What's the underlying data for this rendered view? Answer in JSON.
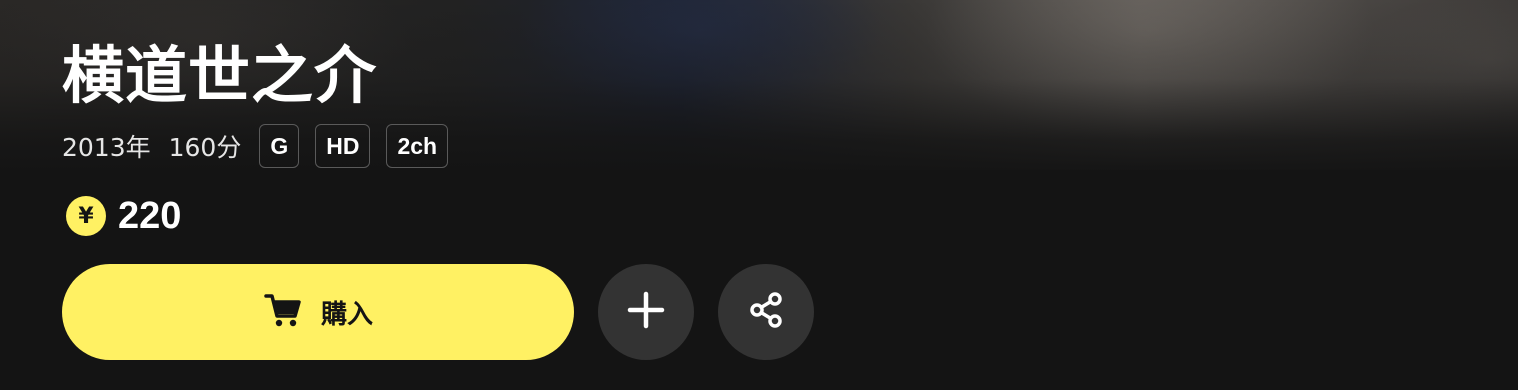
{
  "title": "横道世之介",
  "meta": {
    "year": "2013年",
    "duration": "160分",
    "badges": [
      "G",
      "HD",
      "2ch"
    ]
  },
  "price": {
    "currency_symbol": "¥",
    "amount": "220"
  },
  "actions": {
    "buy_label": "購入",
    "buy_icon": "cart-icon",
    "add_icon": "plus-icon",
    "share_icon": "share-icon"
  },
  "colors": {
    "accent": "#fff163",
    "background": "#141414",
    "round_button": "#333333"
  }
}
